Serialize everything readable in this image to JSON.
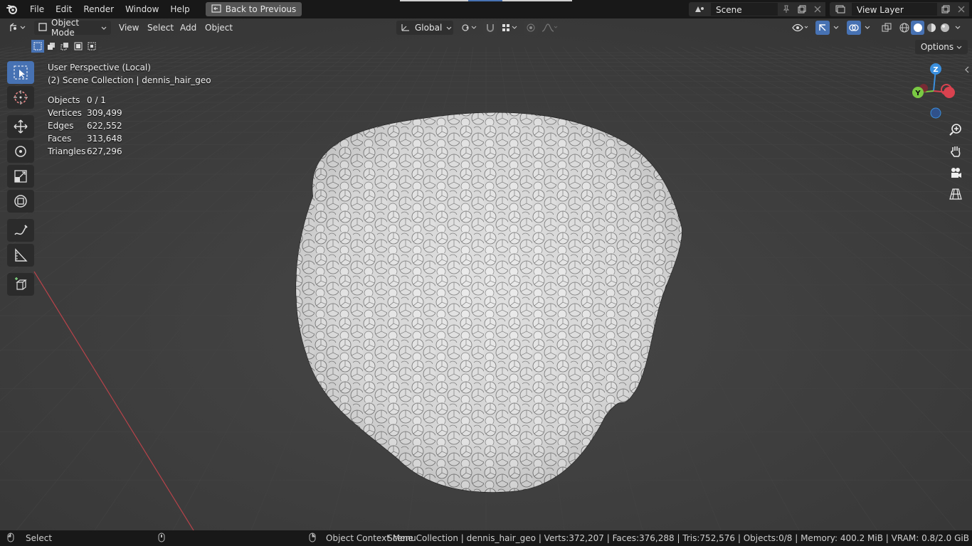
{
  "topbar": {
    "menus": [
      "File",
      "Edit",
      "Render",
      "Window",
      "Help"
    ],
    "back_label": "Back to Previous",
    "scene_name": "Scene",
    "view_layer": "View Layer"
  },
  "header3d": {
    "mode": "Object Mode",
    "menus": [
      "View",
      "Select",
      "Add",
      "Object"
    ],
    "transform_orientation": "Global",
    "options_label": "Options"
  },
  "overlay": {
    "perspective": "User Perspective (Local)",
    "collection": "(2) Scene Collection | dennis_hair_geo"
  },
  "stats": [
    {
      "label": "Objects",
      "value": "0 / 1"
    },
    {
      "label": "Vertices",
      "value": "309,499"
    },
    {
      "label": "Edges",
      "value": "622,552"
    },
    {
      "label": "Faces",
      "value": "313,648"
    },
    {
      "label": "Triangles",
      "value": "627,296"
    }
  ],
  "gizmo": {
    "z": "Z",
    "y": "Y",
    "x": "X"
  },
  "statusbar": {
    "select": "Select",
    "context_menu": "Object Context Menu",
    "info": "Scene Collection | dennis_hair_geo | Verts:372,207 | Faces:376,288 | Tris:752,576 | Objects:0/8 | Memory: 400.2 MiB | VRAM: 0.8/2.0 GiB"
  },
  "colors": {
    "accent": "#4772b3",
    "viewport_bg": "#3b3b3b",
    "x_axis": "#d9424f",
    "y_axis": "#7ac943",
    "z_axis": "#3a8fde"
  }
}
